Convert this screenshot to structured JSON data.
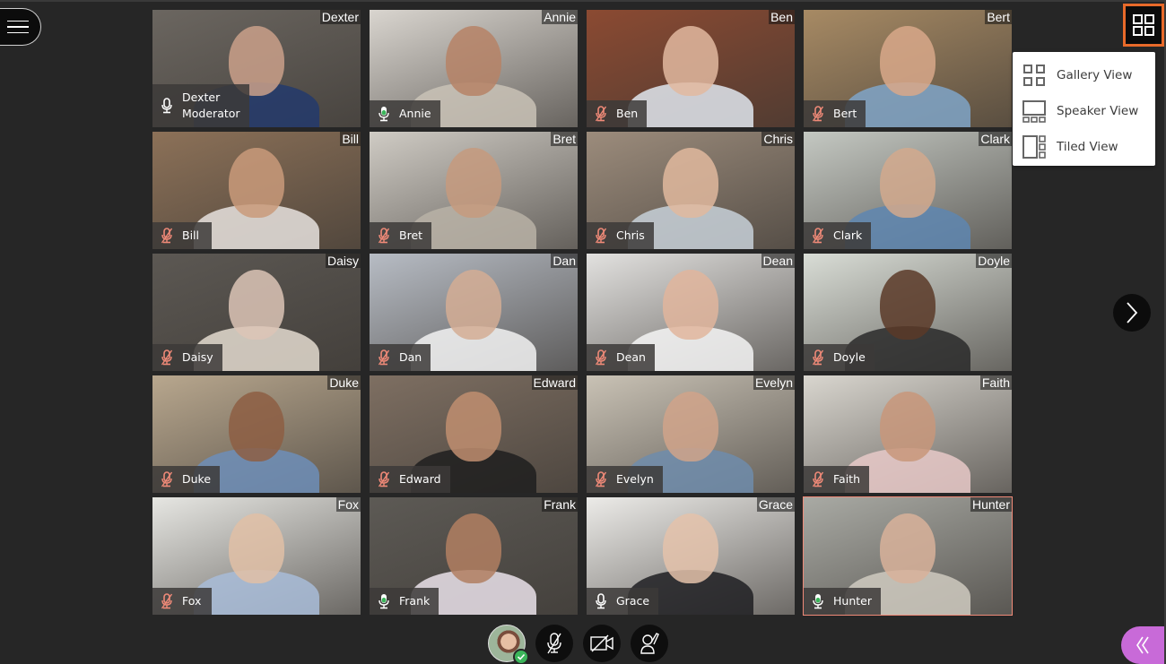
{
  "app": {
    "menu_label": "Open menu",
    "next_page_label": "Next page",
    "layout_button_label": "Change view"
  },
  "layout_menu": {
    "items": [
      {
        "label": "Gallery View",
        "icon": "gallery-view-icon"
      },
      {
        "label": "Speaker View",
        "icon": "speaker-view-icon"
      },
      {
        "label": "Tiled View",
        "icon": "tiled-view-icon"
      }
    ]
  },
  "colors": {
    "accent_orange": "#e86a2a",
    "speaking_border": "#f08a78",
    "muted_mic": "#f08a78",
    "talking_mic": "#3bb55a",
    "collab_panel": "#c86ad8"
  },
  "participants": [
    {
      "name": "Dexter",
      "label": "Dexter",
      "role": "Moderator",
      "mic": "on",
      "speaking": false,
      "bg": "#6b6660",
      "skin": "#caa08a",
      "shirt": "#233a6c"
    },
    {
      "name": "Annie",
      "label": "Annie",
      "role": "",
      "mic": "talking",
      "speaking": false,
      "bg": "#d9d5cf",
      "skin": "#b68366",
      "shirt": "#c9c2b6"
    },
    {
      "name": "Ben",
      "label": "Ben",
      "role": "",
      "mic": "muted",
      "speaking": false,
      "bg": "#8b4a32",
      "skin": "#e2b9a0",
      "shirt": "#dfe6ee"
    },
    {
      "name": "Bert",
      "label": "Bert",
      "role": "",
      "mic": "muted",
      "speaking": false,
      "bg": "#a78a64",
      "skin": "#d8a88a",
      "shirt": "#7fa5c8"
    },
    {
      "name": "Bill",
      "label": "Bill",
      "role": "",
      "mic": "muted",
      "speaking": false,
      "bg": "#8c7158",
      "skin": "#c99a7a",
      "shirt": "#e6e2de"
    },
    {
      "name": "Bret",
      "label": "Bret",
      "role": "",
      "mic": "muted",
      "speaking": false,
      "bg": "#cfcbc4",
      "skin": "#c69a7e",
      "shirt": "#b9b2a6"
    },
    {
      "name": "Chris",
      "label": "Chris",
      "role": "",
      "mic": "muted",
      "speaking": false,
      "bg": "#9c8c7c",
      "skin": "#e0b89d",
      "shirt": "#c7d0d8"
    },
    {
      "name": "Clark",
      "label": "Clark",
      "role": "",
      "mic": "muted",
      "speaking": false,
      "bg": "#c4c8c2",
      "skin": "#d2a98d",
      "shirt": "#5e86b0"
    },
    {
      "name": "Daisy",
      "label": "Daisy",
      "role": "",
      "mic": "muted",
      "speaking": false,
      "bg": "#5c5853",
      "skin": "#dcc4b6",
      "shirt": "#e3dbcf"
    },
    {
      "name": "Dan",
      "label": "Dan",
      "role": "",
      "mic": "muted",
      "speaking": false,
      "bg": "#b7bcc4",
      "skin": "#d4ad94",
      "shirt": "#f2f2f2"
    },
    {
      "name": "Dean",
      "label": "Dean",
      "role": "",
      "mic": "muted",
      "speaking": false,
      "bg": "#e2e1df",
      "skin": "#e0b59c",
      "shirt": "#f4f4f4"
    },
    {
      "name": "Doyle",
      "label": "Doyle",
      "role": "",
      "mic": "muted",
      "speaking": false,
      "bg": "#d9ddd6",
      "skin": "#5a3a28",
      "shirt": "#2a2a2a"
    },
    {
      "name": "Duke",
      "label": "Duke",
      "role": "",
      "mic": "muted",
      "speaking": false,
      "bg": "#b8a78e",
      "skin": "#8d5e43",
      "shirt": "#6d8eb8"
    },
    {
      "name": "Edward",
      "label": "Edward",
      "role": "",
      "mic": "muted",
      "speaking": false,
      "bg": "#7e6f62",
      "skin": "#c08e70",
      "shirt": "#1e1e1e"
    },
    {
      "name": "Evelyn",
      "label": "Evelyn",
      "role": "",
      "mic": "muted",
      "speaking": false,
      "bg": "#c9c2b5",
      "skin": "#d0a389",
      "shirt": "#6f8cac"
    },
    {
      "name": "Faith",
      "label": "Faith",
      "role": "",
      "mic": "muted",
      "speaking": false,
      "bg": "#d9d6cf",
      "skin": "#c8977a",
      "shirt": "#e7c9c8"
    },
    {
      "name": "Fox",
      "label": "Fox",
      "role": "",
      "mic": "muted",
      "speaking": false,
      "bg": "#e6e6e2",
      "skin": "#e1bfa6",
      "shirt": "#a8bcd8"
    },
    {
      "name": "Frank",
      "label": "Frank",
      "role": "",
      "mic": "talking",
      "speaking": false,
      "bg": "#5d5a55",
      "skin": "#b17f62",
      "shirt": "#eae2ea"
    },
    {
      "name": "Grace",
      "label": "Grace",
      "role": "",
      "mic": "on",
      "speaking": false,
      "bg": "#ecebe8",
      "skin": "#e4c2aa",
      "shirt": "#1f1f22"
    },
    {
      "name": "Hunter",
      "label": "Hunter",
      "role": "",
      "mic": "talking",
      "speaking": true,
      "bg": "#a9aaa4",
      "skin": "#d8b19a",
      "shirt": "#cfcac0"
    }
  ],
  "controls": {
    "avatar_label": "My status",
    "mic_label": "Microphone off",
    "camera_label": "Camera off",
    "hand_label": "Raise hand",
    "collab_label": "Open collaborate panel"
  }
}
